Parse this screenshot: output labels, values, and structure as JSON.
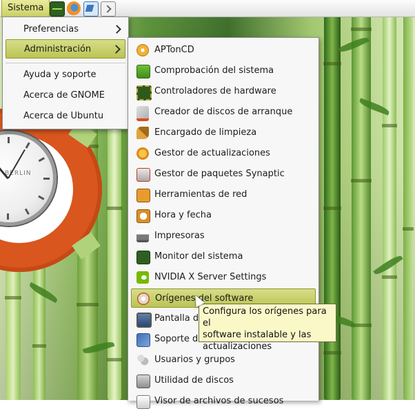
{
  "top_panel": {
    "menu_label": "Sistema",
    "launchers": [
      {
        "icon": "system-monitor-icon"
      },
      {
        "icon": "firefox-icon"
      },
      {
        "icon": "mail-icon"
      },
      {
        "icon": "terminal-icon"
      }
    ]
  },
  "main_menu": {
    "items": [
      {
        "label": "Preferencias",
        "has_submenu": true
      },
      {
        "label": "Administración",
        "has_submenu": true,
        "active": true
      },
      {
        "label": "Ayuda y soporte"
      },
      {
        "label": "Acerca de GNOME"
      },
      {
        "label": "Acerca de Ubuntu"
      }
    ]
  },
  "admin_menu": {
    "items": [
      {
        "label": "APTonCD",
        "icon": "cd-package-icon"
      },
      {
        "label": "Comprobación del sistema",
        "icon": "system-check-icon"
      },
      {
        "label": "Controladores de hardware",
        "icon": "hardware-chip-icon"
      },
      {
        "label": "Creador de discos de arranque",
        "icon": "boot-disk-icon"
      },
      {
        "label": "Encargado de limpieza",
        "icon": "broom-icon"
      },
      {
        "label": "Gestor de actualizaciones",
        "icon": "update-manager-icon"
      },
      {
        "label": "Gestor de paquetes Synaptic",
        "icon": "synaptic-icon"
      },
      {
        "label": "Herramientas de red",
        "icon": "network-tools-icon"
      },
      {
        "label": "Hora y fecha",
        "icon": "clock-date-icon"
      },
      {
        "label": "Impresoras",
        "icon": "printer-icon"
      },
      {
        "label": "Monitor del sistema",
        "icon": "system-monitor-icon"
      },
      {
        "label": "NVIDIA X Server Settings",
        "icon": "nvidia-icon"
      },
      {
        "label": "Orígenes del software",
        "icon": "software-sources-icon",
        "highlighted": true
      },
      {
        "label": "Pantalla d",
        "icon": "display-icon"
      },
      {
        "label": "Soporte de",
        "icon": "language-support-icon"
      },
      {
        "label": "Usuarios y grupos",
        "icon": "users-groups-icon"
      },
      {
        "label": "Utilidad de discos",
        "icon": "disk-utility-icon"
      },
      {
        "label": "Visor de archivos de sucesos",
        "icon": "log-viewer-icon"
      }
    ]
  },
  "tooltip": {
    "lines": [
      "Configura los orígenes para el",
      "software instalable y las",
      "actualizaciones"
    ]
  },
  "clock_widget": {
    "brand": "BERLIN"
  },
  "colors": {
    "highlight": "#c8cf6a",
    "ubuntu_orange": "#d9561e",
    "tooltip_bg": "#fbf8c8"
  }
}
